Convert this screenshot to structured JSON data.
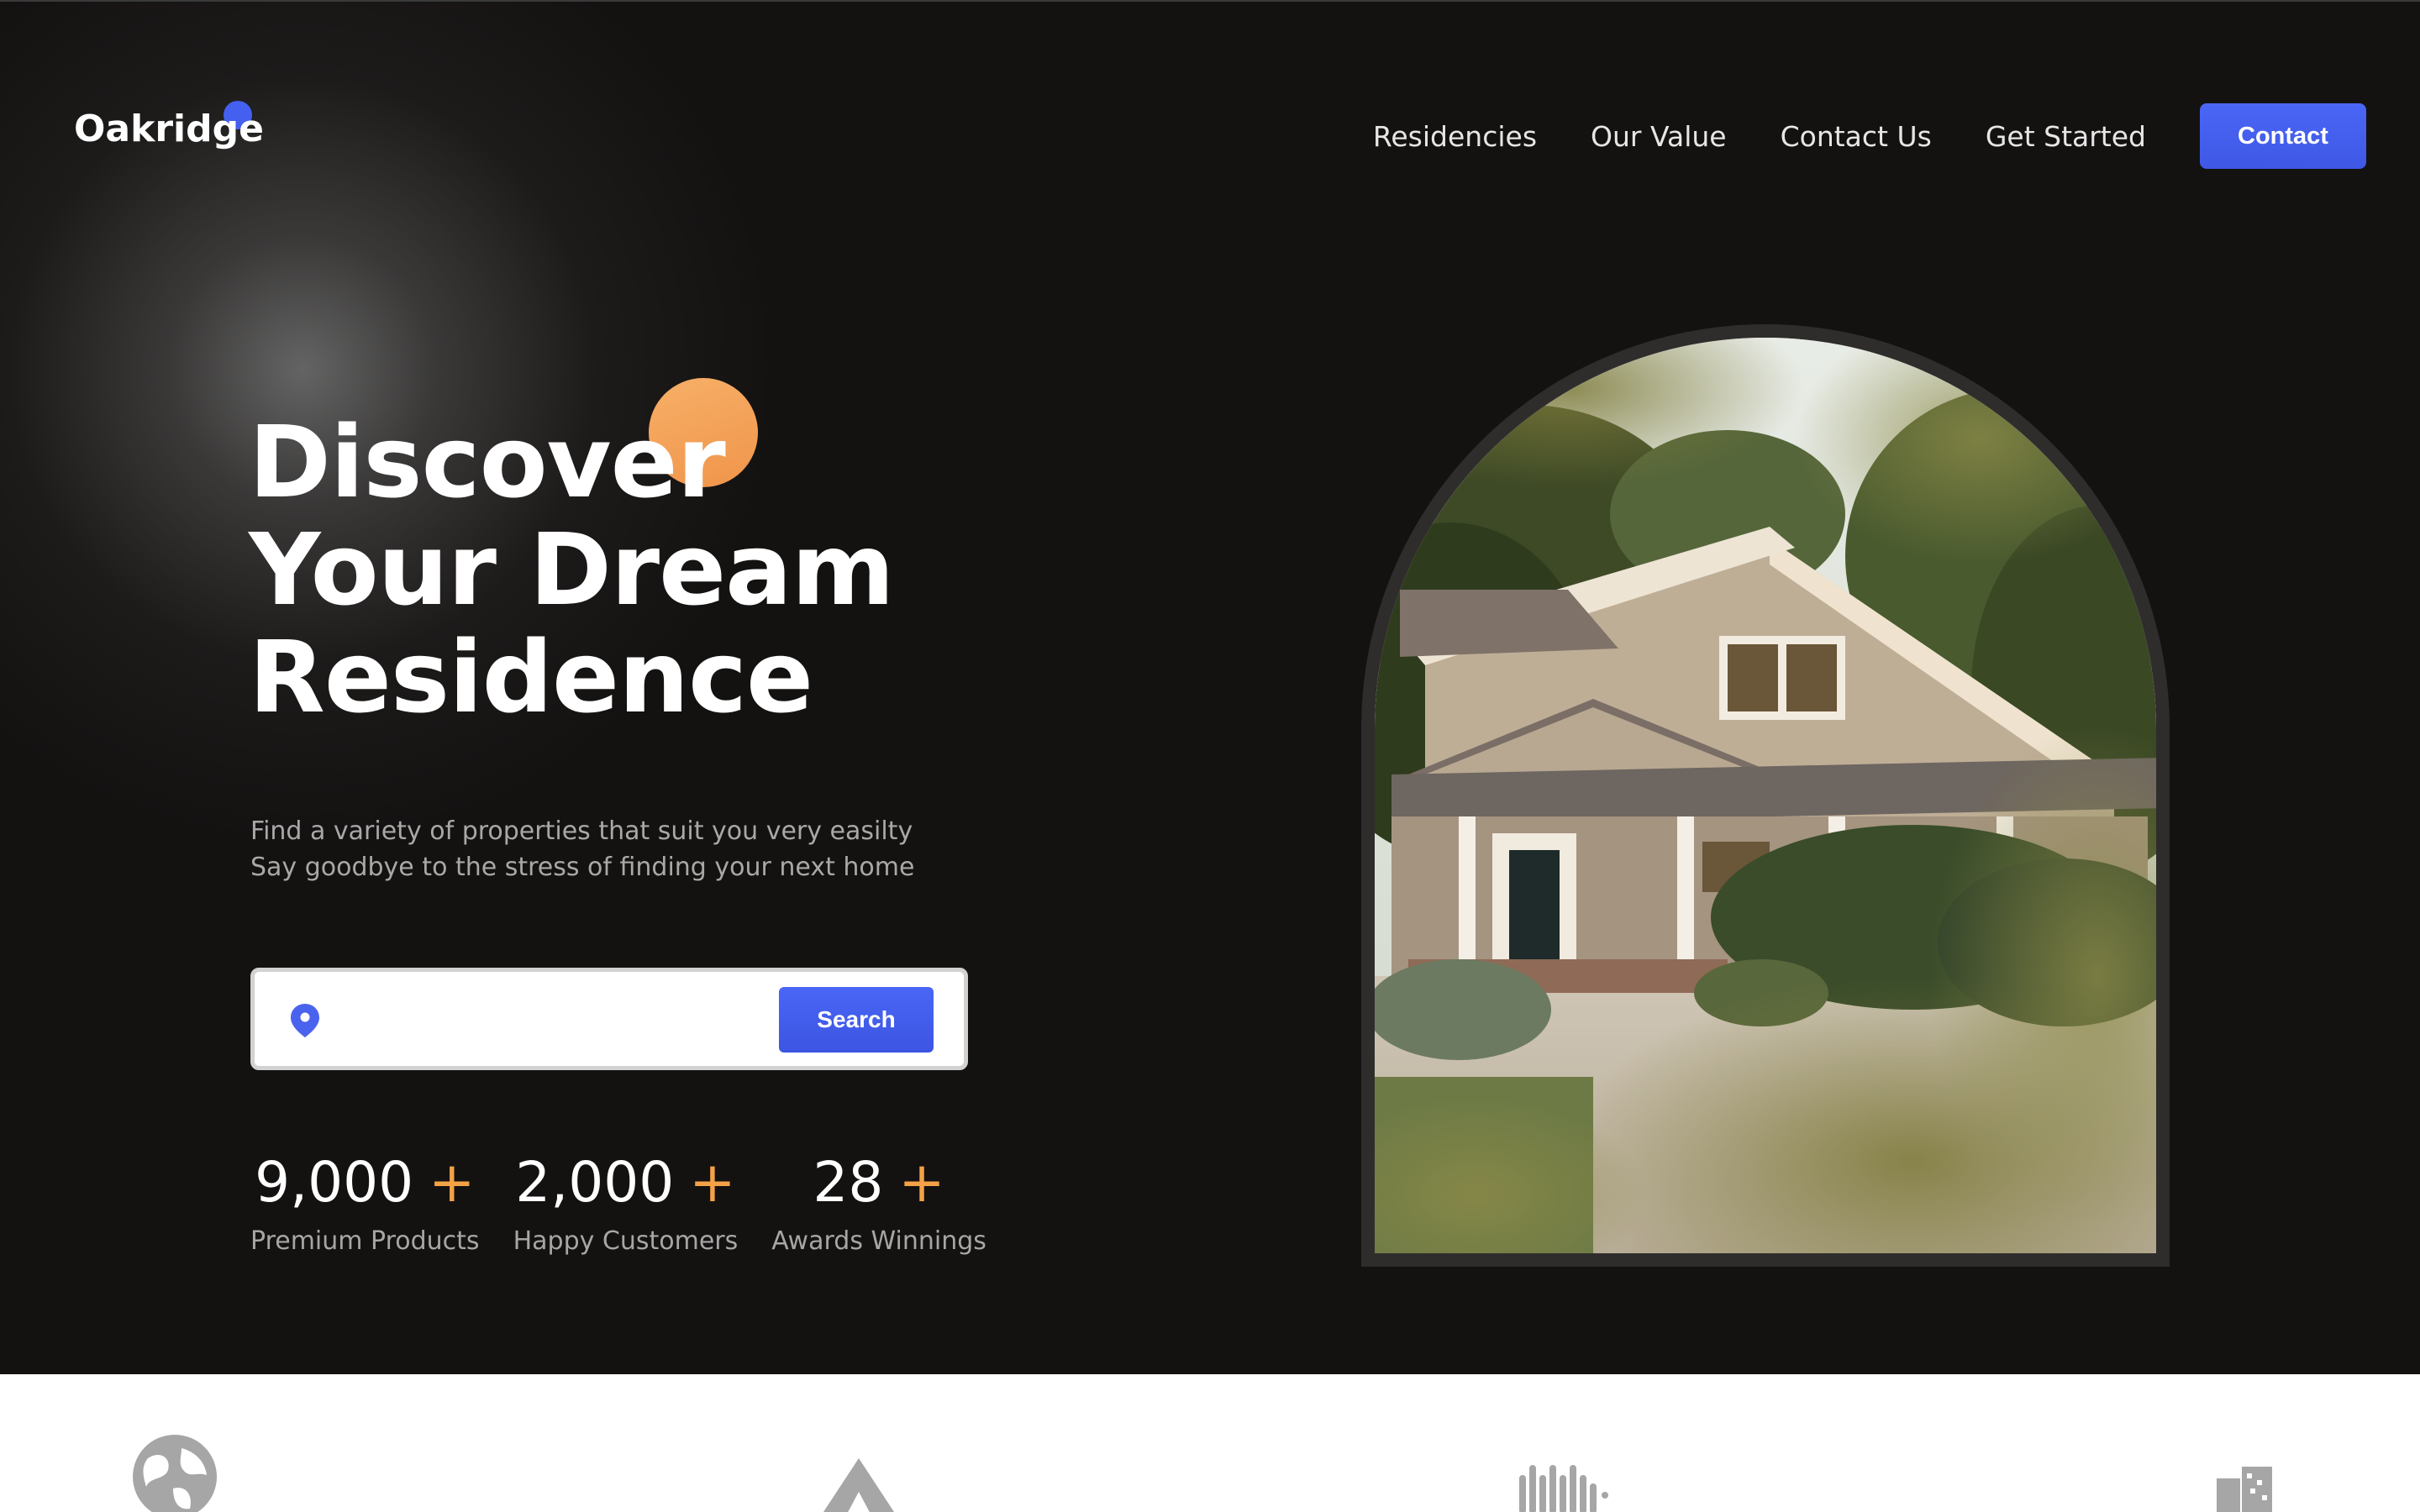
{
  "brand": {
    "name": "Oakridge",
    "accent": "#4460f1"
  },
  "nav": {
    "links": [
      "Residencies",
      "Our Value",
      "Contact Us",
      "Get Started"
    ],
    "cta_label": "Contact"
  },
  "hero": {
    "title_lines": [
      "Discover",
      "Your Dream",
      "Residence"
    ],
    "subtitle_lines": [
      "Find a variety of properties that suit you very easilty",
      "Say goodbye to the stress of finding your next home"
    ]
  },
  "search": {
    "value": "",
    "placeholder": "",
    "button_label": "Search",
    "icon": "location-pin-icon"
  },
  "stats": [
    {
      "value": "9,000",
      "suffix": "+",
      "label": "Premium Products"
    },
    {
      "value": "2,000",
      "suffix": "+",
      "label": "Happy Customers"
    },
    {
      "value": "28",
      "suffix": "+",
      "label": "Awards Winnings"
    }
  ],
  "partners": [
    "globe-logo-icon",
    "triangle-logo-icon",
    "equinix-style-logo-icon",
    "building-logo-icon"
  ],
  "colors": {
    "background": "#141211",
    "accent_blue": "#4460f1",
    "accent_orange": "#f3a247"
  }
}
